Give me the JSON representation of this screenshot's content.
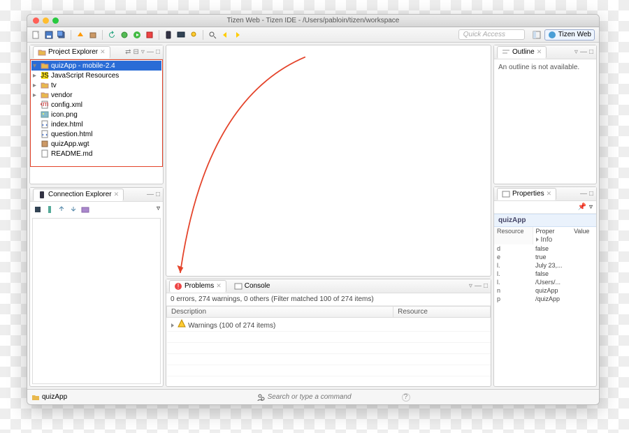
{
  "window": {
    "title": "Tizen Web - Tizen IDE - /Users/pabloin/tizen/workspace"
  },
  "quick_access": {
    "placeholder": "Quick Access"
  },
  "perspectives": {
    "open_label": "",
    "tizen_web": "Tizen Web"
  },
  "project_explorer": {
    "title": "Project Explorer",
    "root": "quizApp - mobile-2.4",
    "nodes": [
      {
        "label": "JavaScript Resources",
        "icon": "js"
      },
      {
        "label": "tv",
        "icon": "folder"
      },
      {
        "label": "vendor",
        "icon": "folder"
      },
      {
        "label": "config.xml",
        "icon": "xml"
      },
      {
        "label": "icon.png",
        "icon": "img"
      },
      {
        "label": "index.html",
        "icon": "html"
      },
      {
        "label": "question.html",
        "icon": "html"
      },
      {
        "label": "quizApp.wgt",
        "icon": "wgt"
      },
      {
        "label": "README.md",
        "icon": "txt"
      }
    ]
  },
  "connection_explorer": {
    "title": "Connection Explorer"
  },
  "outline": {
    "title": "Outline",
    "message": "An outline is not available."
  },
  "problems": {
    "tab_problems": "Problems",
    "tab_console": "Console",
    "summary": "0 errors, 274 warnings, 0 others (Filter matched 100 of 274 items)",
    "col_desc": "Description",
    "col_res": "Resource",
    "warnings_row": "Warnings (100 of 274 items)"
  },
  "properties": {
    "title": "Properties",
    "heading": "quizApp",
    "col_prop": "Proper",
    "col_val": "Value",
    "resource": "Resource",
    "info": "Info",
    "rows": [
      {
        "k": "d",
        "v": "false"
      },
      {
        "k": "e",
        "v": "true"
      },
      {
        "k": "l.",
        "v": "July 23,..."
      },
      {
        "k": "l.",
        "v": "false"
      },
      {
        "k": "l.",
        "v": "/Users/..."
      },
      {
        "k": "n",
        "v": "quizApp"
      },
      {
        "k": "p",
        "v": "/quizApp"
      }
    ]
  },
  "footer": {
    "app": "quizApp",
    "search_placeholder": "Search or type a command",
    "help_tip": "?"
  }
}
